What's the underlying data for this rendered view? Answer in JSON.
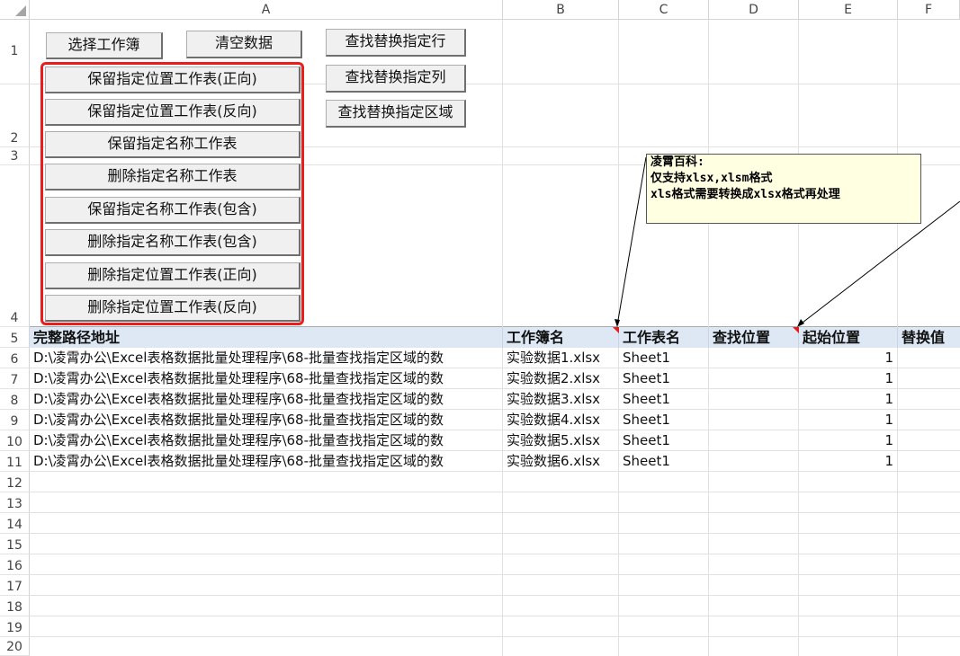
{
  "columns": [
    "A",
    "B",
    "C",
    "D",
    "E",
    "F"
  ],
  "rows": [
    "1",
    "2",
    "3",
    "4",
    "5",
    "6",
    "7",
    "8",
    "9",
    "10",
    "11",
    "12",
    "13",
    "14",
    "15",
    "16",
    "17",
    "18",
    "19",
    "20"
  ],
  "buttons": {
    "select_workbook": "选择工作簿",
    "clear_data": "清空数据",
    "find_replace_row": "查找替换指定行",
    "find_replace_col": "查找替换指定列",
    "find_replace_range": "查找替换指定区域",
    "keep_pos_fwd": "保留指定位置工作表(正向)",
    "keep_pos_rev": "保留指定位置工作表(反向)",
    "keep_name": "保留指定名称工作表",
    "delete_name": "删除指定名称工作表",
    "keep_name_contains": "保留指定名称工作表(包含)",
    "delete_name_contains": "删除指定名称工作表(包含)",
    "delete_pos_fwd": "删除指定位置工作表(正向)",
    "delete_pos_rev": "删除指定位置工作表(反向)"
  },
  "comment": {
    "line1": "凌霄百科:",
    "line2": "仅支持xlsx,xlsm格式",
    "line3": "xls格式需要转换成xlsx格式再处理"
  },
  "table": {
    "headers": [
      "完整路径地址",
      "工作簿名",
      "工作表名",
      "查找位置",
      "起始位置",
      "替换值"
    ],
    "rows": [
      {
        "path": "D:\\凌霄办公\\Excel表格数据批量处理程序\\68-批量查找指定区域的数",
        "book": "实验数据1.xlsx",
        "sheet": "Sheet1",
        "find": "",
        "start": "1",
        "replace": ""
      },
      {
        "path": "D:\\凌霄办公\\Excel表格数据批量处理程序\\68-批量查找指定区域的数",
        "book": "实验数据2.xlsx",
        "sheet": "Sheet1",
        "find": "",
        "start": "1",
        "replace": ""
      },
      {
        "path": "D:\\凌霄办公\\Excel表格数据批量处理程序\\68-批量查找指定区域的数",
        "book": "实验数据3.xlsx",
        "sheet": "Sheet1",
        "find": "",
        "start": "1",
        "replace": ""
      },
      {
        "path": "D:\\凌霄办公\\Excel表格数据批量处理程序\\68-批量查找指定区域的数",
        "book": "实验数据4.xlsx",
        "sheet": "Sheet1",
        "find": "",
        "start": "1",
        "replace": ""
      },
      {
        "path": "D:\\凌霄办公\\Excel表格数据批量处理程序\\68-批量查找指定区域的数",
        "book": "实验数据5.xlsx",
        "sheet": "Sheet1",
        "find": "",
        "start": "1",
        "replace": ""
      },
      {
        "path": "D:\\凌霄办公\\Excel表格数据批量处理程序\\68-批量查找指定区域的数",
        "book": "实验数据6.xlsx",
        "sheet": "Sheet1",
        "find": "",
        "start": "1",
        "replace": ""
      }
    ]
  },
  "colors": {
    "highlight_box": "#ea1c1c",
    "header_fill": "#dde8f4",
    "comment_fill": "#ffffe1",
    "comment_indicator": "#e01e1e"
  }
}
